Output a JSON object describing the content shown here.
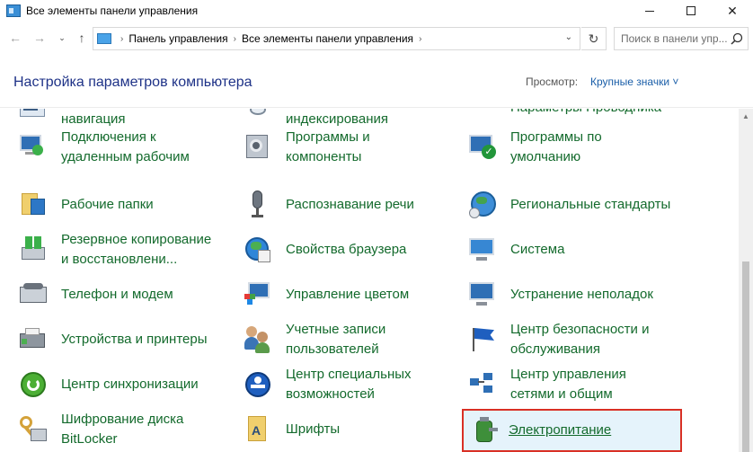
{
  "window": {
    "title": "Все элементы панели управления",
    "controls": {
      "minimize": "minimize",
      "maximize": "maximize",
      "close": "✕"
    }
  },
  "nav": {
    "back": "←",
    "forward": "→",
    "recent": "⌄",
    "up": "↑",
    "breadcrumb": [
      "Панель управления",
      "Все элементы панели управления"
    ],
    "refresh": "↻",
    "search_placeholder": "Поиск в панели упр..."
  },
  "header": {
    "title": "Настройка параметров компьютера",
    "view_label": "Просмотр:",
    "view_value": "Крупные значки ˅"
  },
  "items": [
    {
      "label": "навигация",
      "icon": "navigation-icon",
      "col": 0,
      "row": 0,
      "partial": true
    },
    {
      "label": "индексирования",
      "icon": "indexing-icon",
      "col": 1,
      "row": 0,
      "partial": true
    },
    {
      "label": "Параметры Проводника",
      "icon": "folder-options-icon",
      "col": 2,
      "row": 0
    },
    {
      "label": "Подключения к\nудаленным рабочим",
      "icon": "remote-connection-icon",
      "col": 0,
      "row": 1
    },
    {
      "label": "Программы и\nкомпоненты",
      "icon": "programs-icon",
      "col": 1,
      "row": 1
    },
    {
      "label": "Программы по\nумолчанию",
      "icon": "default-programs-icon",
      "col": 2,
      "row": 1
    },
    {
      "label": "Рабочие папки",
      "icon": "work-folders-icon",
      "col": 0,
      "row": 2
    },
    {
      "label": "Распознавание речи",
      "icon": "microphone-icon",
      "col": 1,
      "row": 2
    },
    {
      "label": "Региональные стандарты",
      "icon": "region-globe-icon",
      "col": 2,
      "row": 2
    },
    {
      "label": "Резервное копирование\nи восстановлени...",
      "icon": "backup-icon",
      "col": 0,
      "row": 3
    },
    {
      "label": "Свойства браузера",
      "icon": "internet-options-icon",
      "col": 1,
      "row": 3
    },
    {
      "label": "Система",
      "icon": "system-icon",
      "col": 2,
      "row": 3
    },
    {
      "label": "Телефон и модем",
      "icon": "phone-modem-icon",
      "col": 0,
      "row": 4
    },
    {
      "label": "Управление цветом",
      "icon": "color-management-icon",
      "col": 1,
      "row": 4
    },
    {
      "label": "Устранение неполадок",
      "icon": "troubleshooting-icon",
      "col": 2,
      "row": 4
    },
    {
      "label": "Устройства и принтеры",
      "icon": "devices-printers-icon",
      "col": 0,
      "row": 5
    },
    {
      "label": "Учетные записи\nпользователей",
      "icon": "user-accounts-icon",
      "col": 1,
      "row": 5
    },
    {
      "label": "Центр безопасности и\nобслуживания",
      "icon": "security-flag-icon",
      "col": 2,
      "row": 5
    },
    {
      "label": "Центр синхронизации",
      "icon": "sync-center-icon",
      "col": 0,
      "row": 6
    },
    {
      "label": "Центр специальных\nвозможностей",
      "icon": "accessibility-icon",
      "col": 1,
      "row": 6
    },
    {
      "label": "Центр управления\nсетями и общим",
      "icon": "network-center-icon",
      "col": 2,
      "row": 6
    },
    {
      "label": "Шифрование диска\nBitLocker",
      "icon": "bitlocker-key-icon",
      "col": 0,
      "row": 7
    },
    {
      "label": "Шрифты",
      "icon": "fonts-icon",
      "col": 1,
      "row": 7
    },
    {
      "label": "Электропитание",
      "icon": "power-options-icon",
      "col": 2,
      "row": 7,
      "selected": true
    }
  ],
  "colors": {
    "link_green": "#136a2c",
    "title_blue": "#1e3287",
    "highlight_border": "#d93025",
    "hover_bg": "#e5f3fb"
  }
}
